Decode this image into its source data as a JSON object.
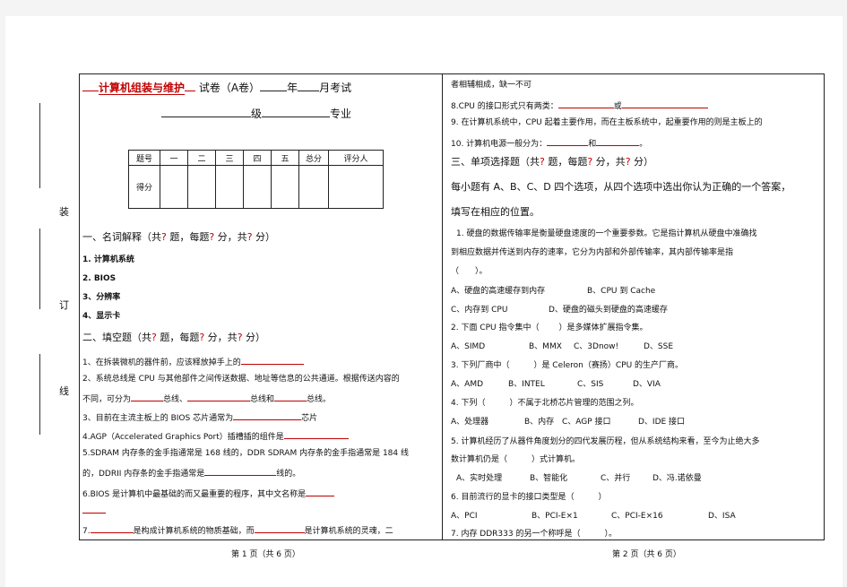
{
  "side": {
    "zhuang": "装",
    "ding": "订",
    "xian": "线"
  },
  "header": {
    "course": "计算机组装与维护",
    "exam": "试卷（A卷）",
    "year": "年",
    "month_exam": "月考试",
    "grade": "级",
    "major": "专业"
  },
  "score_table": {
    "headers": [
      "题号",
      "一",
      "二",
      "三",
      "四",
      "五",
      "总分",
      "评分人"
    ],
    "row_label": "得分"
  },
  "left": {
    "sec1": {
      "a": "一、名词解释（共",
      "q1": "?",
      "b": " 题，每题",
      "q2": "?",
      "c": " 分，共",
      "q3": "?",
      "d": " 分）"
    },
    "terms": [
      "1. 计算机系统",
      "2. BIOS",
      "3、分辨率",
      "4、显示卡"
    ],
    "sec2": {
      "a": "二、填空题（共",
      "q1": "?",
      "b": " 题，每题",
      "q2": "?",
      "c": " 分，共",
      "q3": "?",
      "d": " 分）"
    },
    "f1": "1、在拆装微机的器件前，应该释放掉手上的",
    "f2a": "2、系统总线是 CPU 与其他部件之间传送数据、地址等信息的公共通道。根据传送内容的",
    "f2b1": "不同，可分为",
    "f2b2": "总线、",
    "f2b3": "总线和",
    "f2b4": "总线。",
    "f3a": "3、目前在主流主板上的 BIOS 芯片通常为",
    "f3b": "芯片",
    "f4": "4.AGP（Accelerated Graphics Port）插槽插的组件是",
    "f5a": "5.SDRAM 内存条的金手指通常是 168 线的，DDR SDRAM 内存条的金手指通常是 184 线",
    "f5b1": "的，DDRII 内存条的金手指通常是",
    "f5b2": "线的。",
    "f6": "6.BIOS 是计算机中最基础的而又最重要的程序，其中文名称是",
    "f7a": "7.",
    "f7b": "是构成计算机系统的物质基础，而",
    "f7c": "是计算机系统的灵魂，二"
  },
  "right": {
    "r0": "者相辅相成，缺一不可",
    "r8a": "8.CPU 的接口形式只有两类：",
    "r8b": "或",
    "r9": "9. 在计算机系统中，CPU 起着主要作用，而在主板系统中，起重要作用的则是主板上的",
    "r10a": "10. 计算机电源一般分为：",
    "r10b": "和",
    "r10c": "。",
    "sec3": {
      "a": "三、单项选择题（共",
      "q1": "?",
      "b": " 题，每题",
      "q2": "?",
      "c": " 分，共",
      "q3": "?",
      "d": " 分）"
    },
    "intro1": "每小题有 A、B、C、D 四个选项，从四个选项中选出你认为正确的一个答案，",
    "intro2": "填写在相应的位置。",
    "q1a": "1. 硬盘的数据传输率是衡量硬盘速度的一个重要参数。它是指计算机从硬盘中准确找",
    "q1b": "到相应数据并传送到内存的速率，它分为内部和外部传输率，其内部传输率是指",
    "q1c": "（　　）。",
    "q1oA": "A、硬盘的高速缓存到内存",
    "q1oB": "B、CPU 到 Cache",
    "q1oC": "C、内存到 CPU",
    "q1oD": "D、硬盘的磁头到硬盘的高速缓存",
    "q2a": "2. 下面 CPU 指令集中（",
    "q2b": "）是多媒体扩展指令集。",
    "q2o": [
      "A、SIMD",
      "B、MMX",
      "C、3Dnow!",
      "D、SSE"
    ],
    "q3": "3. 下列厂商中（　　　）是 Celeron（赛扬）CPU 的生产厂商。",
    "q3o": [
      "A、AMD",
      "B、INTEL",
      "C、SIS",
      "D、VIA"
    ],
    "q4": "4. 下列（　　　）不属于北桥芯片管理的范围之列。",
    "q4o": [
      "A、处理器",
      "B、内存",
      "C、AGP 接口",
      "D、IDE 接口"
    ],
    "q5a": "5. 计算机经历了从器件角度划分的四代发展历程，但从系统结构来看，至今为止绝大多",
    "q5b": "数计算机仍是（　　　）式计算机。",
    "q5o": [
      "A、实时处理",
      "B、智能化",
      "C、并行",
      "D、冯.诺依曼"
    ],
    "q6": "6. 目前流行的显卡的接口类型是（　　　）",
    "q6o": [
      "A、PCI",
      "B、PCI-E×1",
      "C、PCI-E×16",
      "D、ISA"
    ],
    "q7": "7. 内存 DDR333 的另一个称呼是（　　　）。"
  },
  "footer": {
    "left": "第 1 页（共 6 页）",
    "right": "第 2 页（共 6 页）"
  }
}
